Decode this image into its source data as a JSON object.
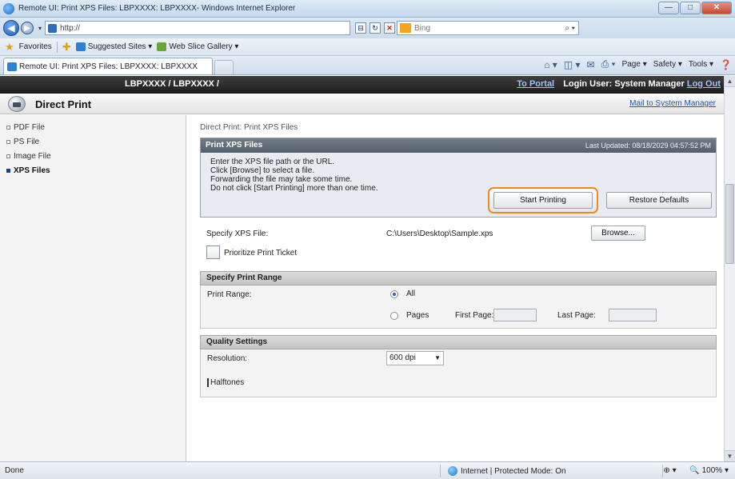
{
  "window": {
    "title": "Remote UI: Print XPS Files: LBPXXXX: LBPXXXX- Windows Internet Explorer",
    "controls": {
      "minimize": "—",
      "maximize": "□",
      "close": "✕"
    }
  },
  "address": {
    "url": "http://",
    "search_placeholder": "Bing"
  },
  "favorites": {
    "label": "Favorites",
    "items": [
      "Suggested Sites ▾",
      "Web Slice Gallery ▾"
    ]
  },
  "tab": {
    "label": "Remote UI: Print XPS Files: LBPXXXX: LBPXXXX"
  },
  "commandbar": {
    "page": "Page ▾",
    "safety": "Safety ▾",
    "tools": "Tools ▾"
  },
  "remote_ui": {
    "device": "LBPXXXX / LBPXXXX /",
    "to_portal": "To Portal",
    "login_user": "Login User: System Manager",
    "logout": "Log Out",
    "page_title": "Direct Print",
    "mail_link": "Mail to System Manager"
  },
  "sidebar": {
    "items": [
      {
        "label": "PDF File",
        "active": false
      },
      {
        "label": "PS File",
        "active": false
      },
      {
        "label": "Image File",
        "active": false
      },
      {
        "label": "XPS Files",
        "active": true
      }
    ]
  },
  "main": {
    "breadcrumb": "Direct Print: Print XPS Files",
    "panel_title": "Print XPS Files",
    "last_updated": "Last Updated: 08/18/2029 04:57:52 PM",
    "instructions": [
      "Enter the XPS file path or the URL.",
      "Click [Browse] to select a file.",
      "Forwarding the file may take some time.",
      "Do not click [Start Printing] more than one time."
    ],
    "start_button": "Start Printing",
    "restore_button": "Restore Defaults",
    "specify_label": "Specify XPS File:",
    "file_path": "C:\\Users\\Desktop\\Sample.xps",
    "browse_button": "Browse...",
    "prioritize_label": "Prioritize Print Ticket",
    "range_section": "Specify Print Range",
    "range_label": "Print Range:",
    "range_all": "All",
    "range_pages": "Pages",
    "first_page": "First Page:",
    "last_page": "Last Page:",
    "quality_section": "Quality Settings",
    "resolution_label": "Resolution:",
    "resolution_value": "600 dpi",
    "halftones_label": "Halftones"
  },
  "status": {
    "done": "Done",
    "zone": "Internet | Protected Mode: On",
    "zoom": "100%"
  }
}
